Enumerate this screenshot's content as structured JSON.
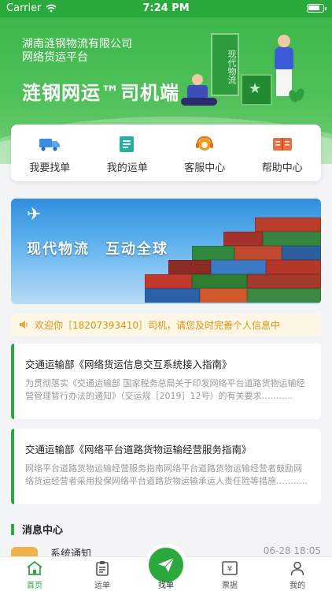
{
  "status": {
    "carrier": "Carrier",
    "time": "7:24 PM"
  },
  "hero": {
    "company_line1": "湖南涟钢物流有限公司",
    "company_line2": "网络货运平台",
    "title": "涟钢网运™司机端",
    "board_text": "现代物流"
  },
  "menu": [
    {
      "label": "我要找单",
      "icon": "truck-icon"
    },
    {
      "label": "我的运单",
      "icon": "document-icon"
    },
    {
      "label": "客服中心",
      "icon": "headset-icon"
    },
    {
      "label": "帮助中心",
      "icon": "book-icon"
    }
  ],
  "banner": {
    "text": "现代物流　互动全球"
  },
  "notice": {
    "text": "欢迎你［18207393410］司机，请您及时完善个人信息中"
  },
  "news": [
    {
      "title": "交通运输部《网络货运信息交互系统接入指南》",
      "desc": "为贯彻落实《交通运输部 国家税务总局关于印发网络平台道路货物运输经营管理暂行办法的通知》（交运规［2019］12号）的有关要求……….."
    },
    {
      "title": "交通运输部《网络平台道路货物运输经营服务指南》",
      "desc": "网络平台道路货物运输经营服务指南网络平台道路货物运输经营者鼓励网络货运经营者采用投保网络平台道路货物运输承运人责任险等措施……….."
    }
  ],
  "messages": {
    "section_title": "消息中心",
    "items": [
      {
        "title": "系统通知",
        "time": "06-28 18:05"
      }
    ]
  },
  "tabbar": {
    "tabs": [
      {
        "label": "首页",
        "icon": "home-icon",
        "active": true
      },
      {
        "label": "运单",
        "icon": "clipboard-icon",
        "active": false
      },
      {
        "label": "找单",
        "icon": "paper-plane-icon",
        "active": false
      },
      {
        "label": "票据",
        "icon": "receipt-icon",
        "active": false
      },
      {
        "label": "我的",
        "icon": "user-icon",
        "active": false
      }
    ]
  },
  "colors": {
    "primary": "#2aa93c",
    "notice_text": "#e19310",
    "notice_bg": "#fff7e5"
  }
}
